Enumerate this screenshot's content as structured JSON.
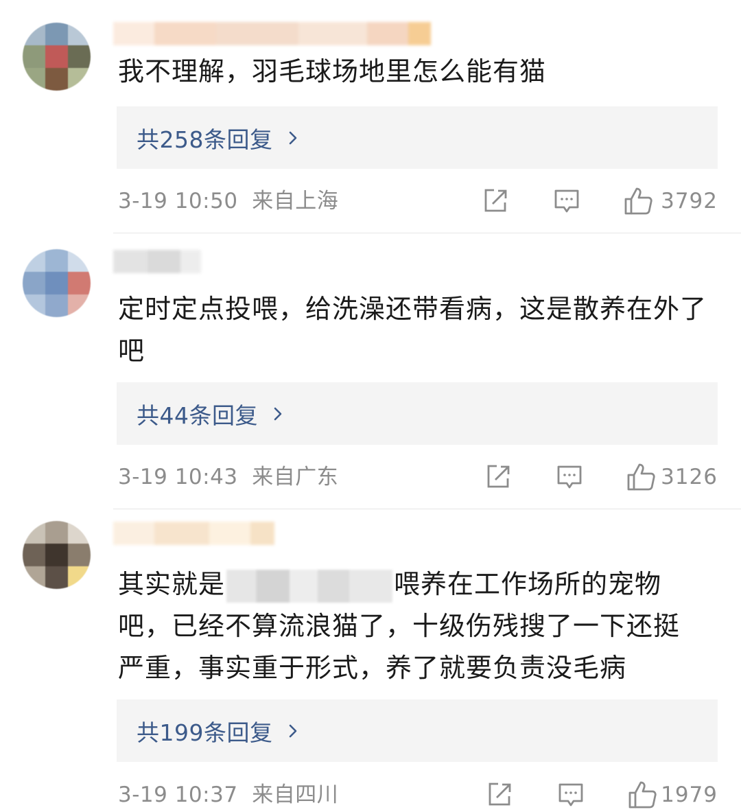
{
  "comments": [
    {
      "text": "我不理解，羽毛球场地里怎么能有猫",
      "replies_label": "共258条回复",
      "time": "3-19 10:50",
      "location": "来自上海",
      "likes": "3792"
    },
    {
      "text": "定时定点投喂，给洗澡还带看病，这是散养在外了吧",
      "replies_label": "共44条回复",
      "time": "3-19 10:43",
      "location": "来自广东",
      "likes": "3126"
    },
    {
      "text_before": "其实就是",
      "text_after": "喂养在工作场所的宠物",
      "text_line2": "吧，已经不算流浪猫了，十级伤残搜了一下还挺",
      "text_line3": "严重，事实重于形式，养了就要负责没毛病",
      "replies_label": "共199条回复",
      "time": "3-19 10:37",
      "location": "来自四川",
      "likes": "1979"
    }
  ],
  "icons": [
    "share-icon",
    "comment-icon",
    "like-icon",
    "chevron-right-icon"
  ],
  "colors": {
    "reply_link": "#3c5a8a",
    "meta_text": "#8c8c8c",
    "reply_box_bg": "#f4f4f4"
  }
}
